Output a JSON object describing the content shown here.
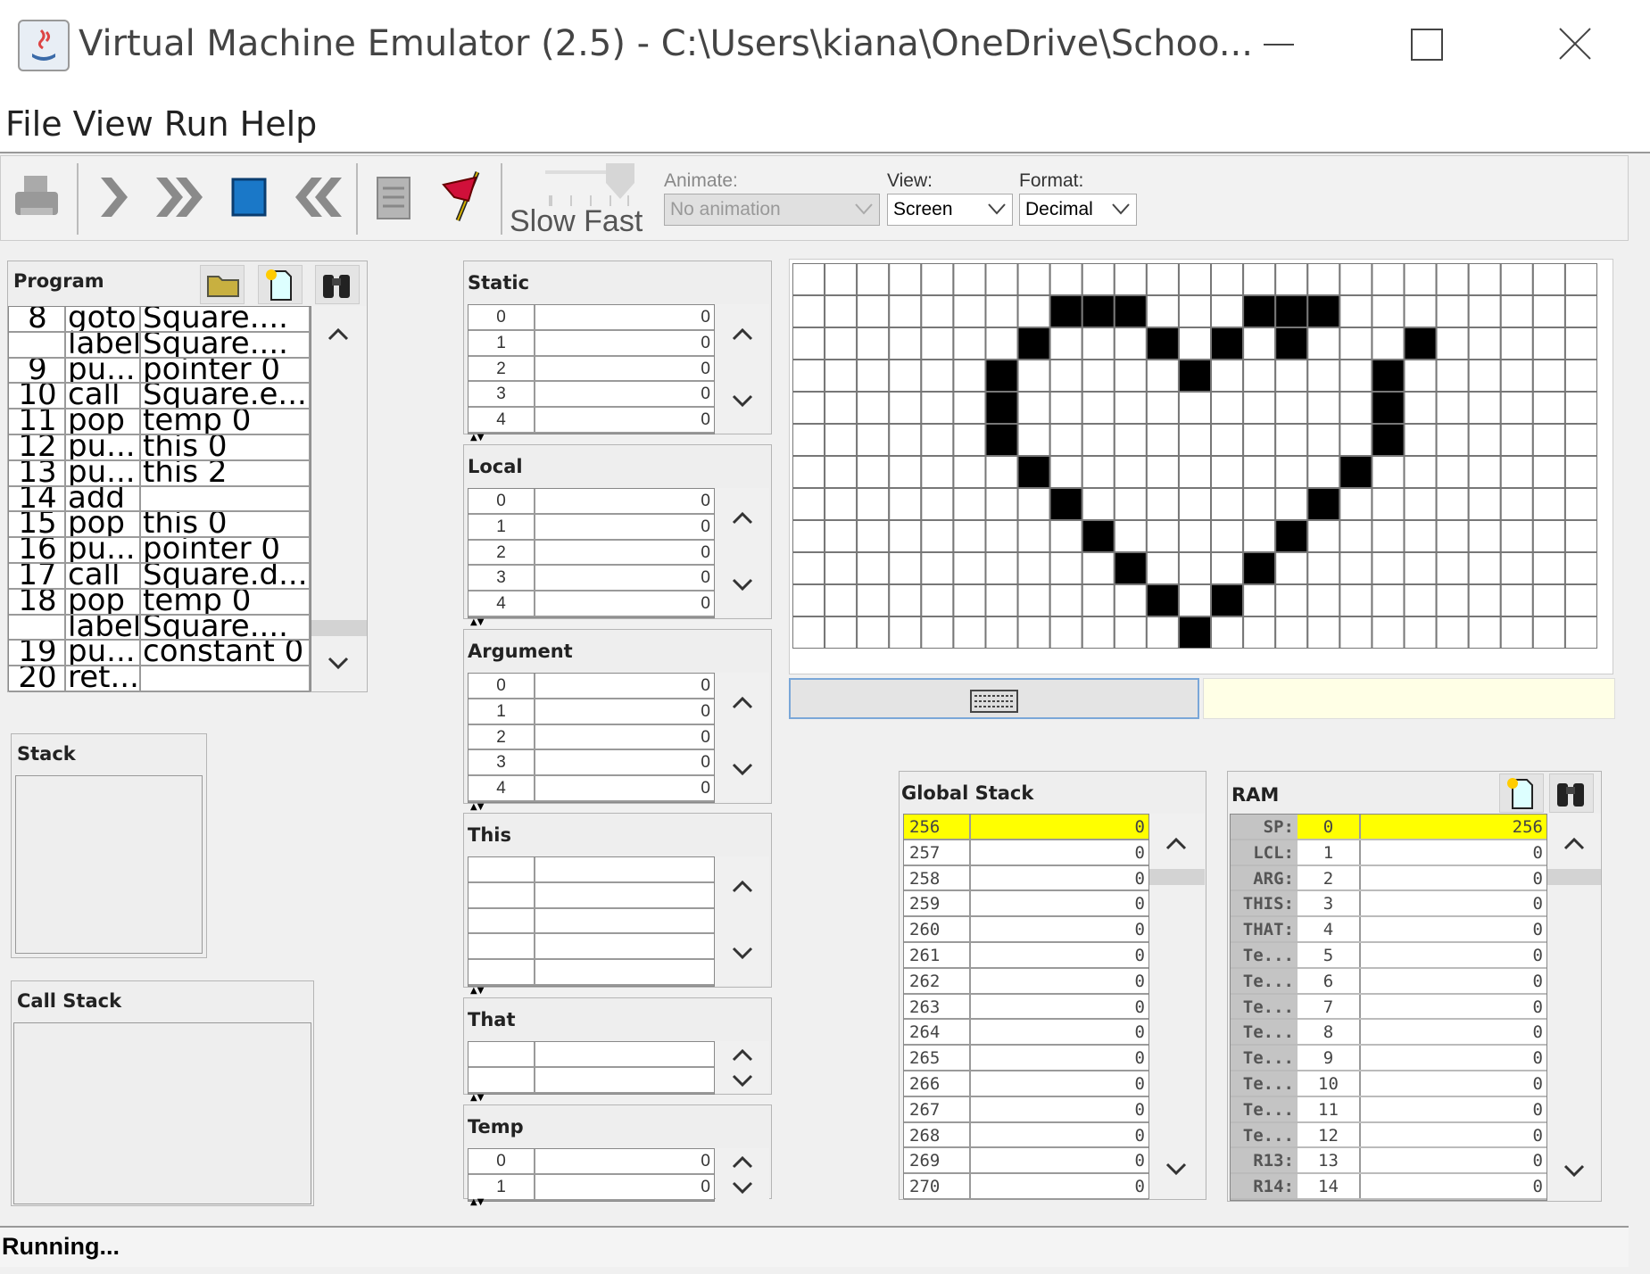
{
  "window": {
    "title": "Virtual Machine Emulator (2.5) - C:\\Users\\kiana\\OneDrive\\Schoo...",
    "controls": [
      "minimize-icon",
      "maximize-icon",
      "close-icon"
    ]
  },
  "menu": [
    "File",
    "View",
    "Run",
    "Help"
  ],
  "toolbar": {
    "icons": [
      "load-program-icon",
      "single-step-icon",
      "fast-forward-icon",
      "stop-icon",
      "rewind-icon",
      "script-icon",
      "breakpoints-flag-icon"
    ],
    "speed": {
      "slow_label": "Slow",
      "fast_label": "Fast"
    },
    "animate": {
      "label": "Animate:",
      "value": "No animation",
      "disabled": true
    },
    "view": {
      "label": "View:",
      "value": "Screen"
    },
    "format": {
      "label": "Format:",
      "value": "Decimal"
    }
  },
  "program": {
    "title": "Program",
    "rows": [
      [
        "8",
        "goto",
        "Square...."
      ],
      [
        "",
        "label",
        "Square...."
      ],
      [
        "9",
        "pu...",
        "pointer 0"
      ],
      [
        "10",
        "call",
        "Square.e..."
      ],
      [
        "11",
        "pop",
        "temp 0"
      ],
      [
        "12",
        "pu...",
        "this 0"
      ],
      [
        "13",
        "pu...",
        "this 2"
      ],
      [
        "14",
        "add",
        ""
      ],
      [
        "15",
        "pop",
        "this 0"
      ],
      [
        "16",
        "pu...",
        "pointer 0"
      ],
      [
        "17",
        "call",
        "Square.d..."
      ],
      [
        "18",
        "pop",
        "temp 0"
      ],
      [
        "",
        "label",
        "Square...."
      ],
      [
        "19",
        "pu...",
        "constant 0"
      ],
      [
        "20",
        "ret...",
        ""
      ]
    ]
  },
  "stack": {
    "title": "Stack"
  },
  "call_stack": {
    "title": "Call Stack"
  },
  "segments": {
    "static": {
      "title": "Static",
      "rows": [
        [
          "0",
          "0"
        ],
        [
          "1",
          "0"
        ],
        [
          "2",
          "0"
        ],
        [
          "3",
          "0"
        ],
        [
          "4",
          "0"
        ]
      ]
    },
    "local": {
      "title": "Local",
      "rows": [
        [
          "0",
          "0"
        ],
        [
          "1",
          "0"
        ],
        [
          "2",
          "0"
        ],
        [
          "3",
          "0"
        ],
        [
          "4",
          "0"
        ]
      ]
    },
    "argument": {
      "title": "Argument",
      "rows": [
        [
          "0",
          "0"
        ],
        [
          "1",
          "0"
        ],
        [
          "2",
          "0"
        ],
        [
          "3",
          "0"
        ],
        [
          "4",
          "0"
        ]
      ]
    },
    "this": {
      "title": "This",
      "rows": [
        [
          "",
          ""
        ],
        [
          "",
          ""
        ],
        [
          "",
          ""
        ],
        [
          "",
          ""
        ],
        [
          "",
          ""
        ]
      ]
    },
    "that": {
      "title": "That",
      "rows": [
        [
          "",
          ""
        ],
        [
          "",
          ""
        ]
      ]
    },
    "temp": {
      "title": "Temp",
      "rows": [
        [
          "0",
          "0"
        ],
        [
          "1",
          "0"
        ]
      ]
    }
  },
  "screen": {
    "pixels": [
      "0000000000000000000000000",
      "0000000011100011100000000",
      "0000000100010101000100000",
      "0000001000001000001000000",
      "0000001000000000001000000",
      "0000001000000000001000000",
      "0000000100000000010000000",
      "0000000010000000100000000",
      "0000000001000001000000000",
      "0000000000100010000000000",
      "0000000000010100000000000",
      "0000000000001000000000000"
    ]
  },
  "keyboard": {
    "icon": "keyboard-icon",
    "value": ""
  },
  "global_stack": {
    "title": "Global Stack",
    "highlight_color": "#ffff00",
    "rows": [
      [
        "256",
        "0"
      ],
      [
        "257",
        "0"
      ],
      [
        "258",
        "0"
      ],
      [
        "259",
        "0"
      ],
      [
        "260",
        "0"
      ],
      [
        "261",
        "0"
      ],
      [
        "262",
        "0"
      ],
      [
        "263",
        "0"
      ],
      [
        "264",
        "0"
      ],
      [
        "265",
        "0"
      ],
      [
        "266",
        "0"
      ],
      [
        "267",
        "0"
      ],
      [
        "268",
        "0"
      ],
      [
        "269",
        "0"
      ],
      [
        "270",
        "0"
      ]
    ]
  },
  "ram": {
    "title": "RAM",
    "rows": [
      [
        "SP:",
        "0",
        "256"
      ],
      [
        "LCL:",
        "1",
        "0"
      ],
      [
        "ARG:",
        "2",
        "0"
      ],
      [
        "THIS:",
        "3",
        "0"
      ],
      [
        "THAT:",
        "4",
        "0"
      ],
      [
        "Te...",
        "5",
        "0"
      ],
      [
        "Te...",
        "6",
        "0"
      ],
      [
        "Te...",
        "7",
        "0"
      ],
      [
        "Te...",
        "8",
        "0"
      ],
      [
        "Te...",
        "9",
        "0"
      ],
      [
        "Te...",
        "10",
        "0"
      ],
      [
        "Te...",
        "11",
        "0"
      ],
      [
        "Te...",
        "12",
        "0"
      ],
      [
        "R13:",
        "13",
        "0"
      ],
      [
        "R14:",
        "14",
        "0"
      ]
    ]
  },
  "status": "Running..."
}
